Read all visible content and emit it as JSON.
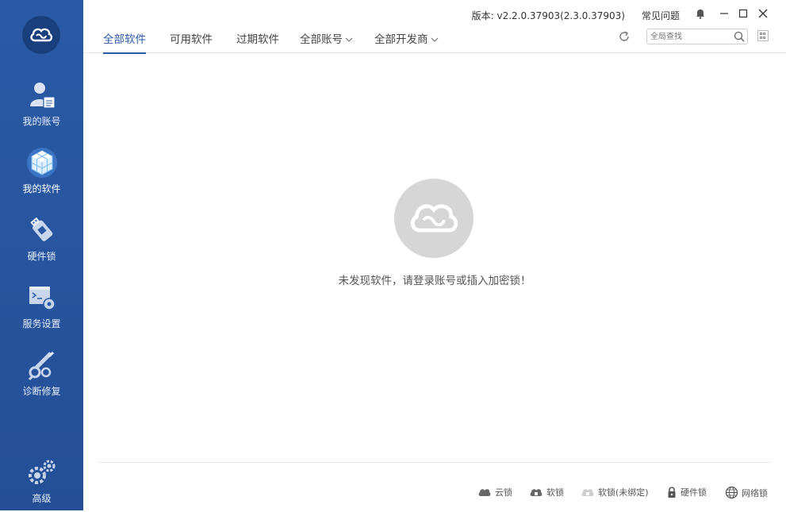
{
  "titlebar": {
    "version": "版本: v2.2.0.37903(2.3.0.37903)",
    "faq": "常见问题"
  },
  "sidebar": {
    "items": [
      {
        "label": "我的账号",
        "icon": "user-account-icon"
      },
      {
        "label": "我的软件",
        "icon": "cube-software-icon",
        "active": true
      },
      {
        "label": "硬件锁",
        "icon": "usb-dongle-icon"
      },
      {
        "label": "服务设置",
        "icon": "terminal-gear-icon"
      },
      {
        "label": "诊断修复",
        "icon": "wrench-icon"
      },
      {
        "label": "高级",
        "icon": "gears-icon"
      }
    ]
  },
  "tabs": [
    {
      "label": "全部软件",
      "active": true
    },
    {
      "label": "可用软件"
    },
    {
      "label": "过期软件"
    },
    {
      "label": "全部账号",
      "dropdown": true
    },
    {
      "label": "全部开发商",
      "dropdown": true
    }
  ],
  "search": {
    "placeholder": "全局查找"
  },
  "main": {
    "empty_message": "未发现软件，请登录账号或插入加密锁！"
  },
  "legend": [
    {
      "label": "云锁",
      "icon": "cloud-icon"
    },
    {
      "label": "软锁",
      "icon": "cloud-lock-icon"
    },
    {
      "label": "软锁(未绑定)",
      "icon": "cloud-unbound-icon"
    },
    {
      "label": "硬件锁",
      "icon": "padlock-icon"
    },
    {
      "label": "网络锁",
      "icon": "network-globe-icon"
    }
  ],
  "colors": {
    "sidebar": "#2a5aa6",
    "accent": "#2a5aa6",
    "empty_logo": "#d6d6d6"
  }
}
